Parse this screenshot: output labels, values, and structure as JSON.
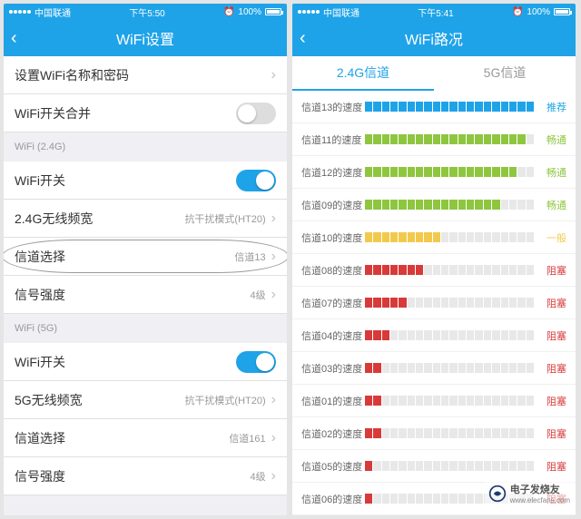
{
  "left": {
    "status": {
      "carrier": "中国联通",
      "time": "下午5:50",
      "battery": "100%"
    },
    "nav": {
      "title": "WiFi设置"
    },
    "rows": {
      "name_pwd": "设置WiFi名称和密码",
      "merge": "WiFi开关合并",
      "sec_24": "WiFi (2.4G)",
      "sw": "WiFi开关",
      "bw24": "2.4G无线频宽",
      "bw24v": "抗干扰模式(HT20)",
      "chsel": "信道选择",
      "chsel24v": "信道13",
      "sig": "信号强度",
      "sigv": "4级",
      "sec_5": "WiFi (5G)",
      "bw5": "5G无线频宽",
      "bw5v": "抗干扰模式(HT20)",
      "chsel5v": "信道161"
    }
  },
  "right": {
    "status": {
      "carrier": "中国联通",
      "time": "下午5:41",
      "battery": "100%"
    },
    "nav": {
      "title": "WiFi路况"
    },
    "tabs": {
      "t1": "2.4G信道",
      "t2": "5G信道"
    },
    "status_labels": {
      "rec": "推荐",
      "good": "畅通",
      "mid": "一般",
      "bad": "阻塞"
    },
    "colors": {
      "blue": "#1fa3e8",
      "green": "#8ec63f",
      "yellow": "#f2c94c",
      "red": "#d83a3a"
    },
    "channels": [
      {
        "name": "信道13的速度",
        "fill": 20,
        "color": "blue",
        "status": "rec"
      },
      {
        "name": "信道11的速度",
        "fill": 19,
        "color": "green",
        "status": "good"
      },
      {
        "name": "信道12的速度",
        "fill": 18,
        "color": "green",
        "status": "good"
      },
      {
        "name": "信道09的速度",
        "fill": 16,
        "color": "green",
        "status": "good"
      },
      {
        "name": "信道10的速度",
        "fill": 9,
        "color": "yellow",
        "status": "mid"
      },
      {
        "name": "信道08的速度",
        "fill": 7,
        "color": "red",
        "status": "bad"
      },
      {
        "name": "信道07的速度",
        "fill": 5,
        "color": "red",
        "status": "bad"
      },
      {
        "name": "信道04的速度",
        "fill": 3,
        "color": "red",
        "status": "bad"
      },
      {
        "name": "信道03的速度",
        "fill": 2,
        "color": "red",
        "status": "bad"
      },
      {
        "name": "信道01的速度",
        "fill": 2,
        "color": "red",
        "status": "bad"
      },
      {
        "name": "信道02的速度",
        "fill": 2,
        "color": "red",
        "status": "bad"
      },
      {
        "name": "信道05的速度",
        "fill": 1,
        "color": "red",
        "status": "bad"
      },
      {
        "name": "信道06的速度",
        "fill": 1,
        "color": "red",
        "status": "bad"
      }
    ]
  },
  "watermark": {
    "text": "电子发烧友",
    "sub": "www.elecfans.com"
  }
}
